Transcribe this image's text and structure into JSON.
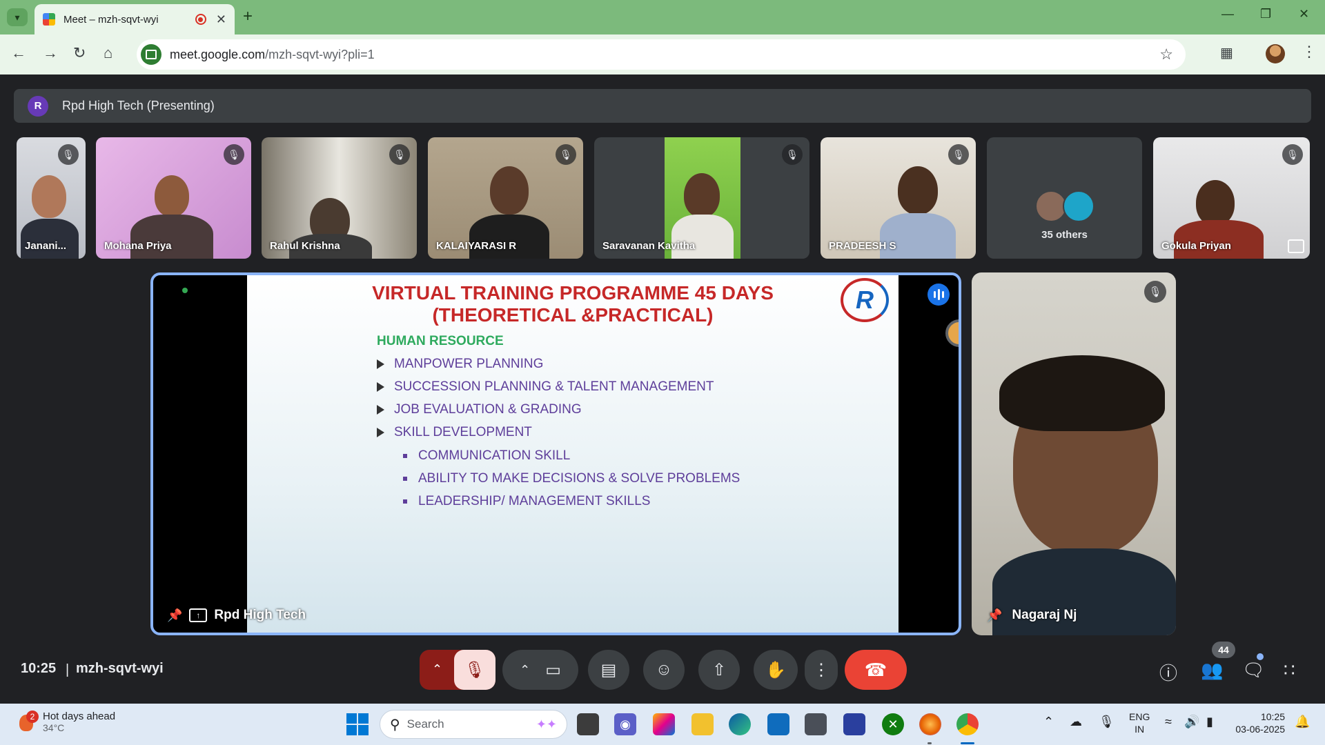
{
  "browser": {
    "tab_title": "Meet – mzh-sqvt-wyi",
    "url_host": "meet.google.com",
    "url_path": "/mzh-sqvt-wyi?pli=1"
  },
  "meet": {
    "presenting_banner": "Rpd High Tech (Presenting)",
    "presenter_initial": "R",
    "participants": [
      {
        "name": "Janani..."
      },
      {
        "name": "Mohana Priya"
      },
      {
        "name": "Rahul Krishna"
      },
      {
        "name": "KALAIYARASI R"
      },
      {
        "name": "Saravanan Kavitha"
      },
      {
        "name": "PRADEESH S"
      },
      {
        "name": "Gokula Priyan"
      }
    ],
    "others_label": "35 others",
    "presentation_label": "Rpd High Tech",
    "pinned_name": "Nagaraj Nj",
    "time": "10:25",
    "meeting_code": "mzh-sqvt-wyi",
    "participant_count": "44",
    "accent_end_call": "#ea4335",
    "accent_border": "#8ab4f8"
  },
  "slide": {
    "title_line1": "VIRTUAL TRAINING PROGRAMME 45 DAYS",
    "title_line2": "(THEORETICAL &PRACTICAL)",
    "logo": "R",
    "section": "HUMAN RESOURCE",
    "items": [
      "MANPOWER PLANNING",
      "SUCCESSION PLANNING & TALENT MANAGEMENT",
      "JOB EVALUATION & GRADING",
      "SKILL DEVELOPMENT"
    ],
    "subitems": [
      "COMMUNICATION SKILL",
      "ABILITY TO MAKE DECISIONS & SOLVE PROBLEMS",
      "LEADERSHIP/ MANAGEMENT SKILLS"
    ]
  },
  "taskbar": {
    "weather_count": "2",
    "weather_title": "Hot days ahead",
    "weather_temp": "34°C",
    "search_placeholder": "Search",
    "lang_line1": "ENG",
    "lang_line2": "IN",
    "clock_time": "10:25",
    "clock_date": "03-06-2025"
  }
}
